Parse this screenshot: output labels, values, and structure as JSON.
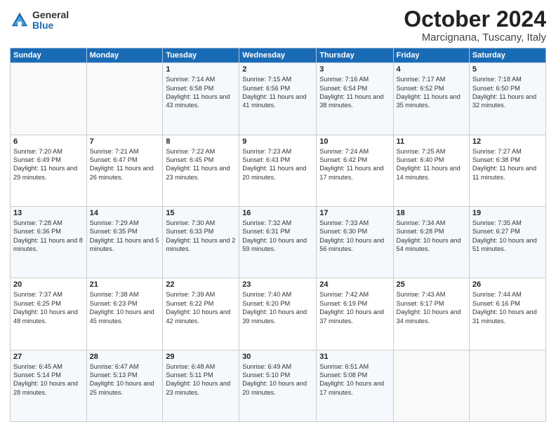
{
  "logo": {
    "general": "General",
    "blue": "Blue"
  },
  "title": "October 2024",
  "location": "Marcignana, Tuscany, Italy",
  "headers": [
    "Sunday",
    "Monday",
    "Tuesday",
    "Wednesday",
    "Thursday",
    "Friday",
    "Saturday"
  ],
  "weeks": [
    [
      {
        "day": "",
        "sunrise": "",
        "sunset": "",
        "daylight": ""
      },
      {
        "day": "",
        "sunrise": "",
        "sunset": "",
        "daylight": ""
      },
      {
        "day": "1",
        "sunrise": "Sunrise: 7:14 AM",
        "sunset": "Sunset: 6:58 PM",
        "daylight": "Daylight: 11 hours and 43 minutes."
      },
      {
        "day": "2",
        "sunrise": "Sunrise: 7:15 AM",
        "sunset": "Sunset: 6:56 PM",
        "daylight": "Daylight: 11 hours and 41 minutes."
      },
      {
        "day": "3",
        "sunrise": "Sunrise: 7:16 AM",
        "sunset": "Sunset: 6:54 PM",
        "daylight": "Daylight: 11 hours and 38 minutes."
      },
      {
        "day": "4",
        "sunrise": "Sunrise: 7:17 AM",
        "sunset": "Sunset: 6:52 PM",
        "daylight": "Daylight: 11 hours and 35 minutes."
      },
      {
        "day": "5",
        "sunrise": "Sunrise: 7:18 AM",
        "sunset": "Sunset: 6:50 PM",
        "daylight": "Daylight: 11 hours and 32 minutes."
      }
    ],
    [
      {
        "day": "6",
        "sunrise": "Sunrise: 7:20 AM",
        "sunset": "Sunset: 6:49 PM",
        "daylight": "Daylight: 11 hours and 29 minutes."
      },
      {
        "day": "7",
        "sunrise": "Sunrise: 7:21 AM",
        "sunset": "Sunset: 6:47 PM",
        "daylight": "Daylight: 11 hours and 26 minutes."
      },
      {
        "day": "8",
        "sunrise": "Sunrise: 7:22 AM",
        "sunset": "Sunset: 6:45 PM",
        "daylight": "Daylight: 11 hours and 23 minutes."
      },
      {
        "day": "9",
        "sunrise": "Sunrise: 7:23 AM",
        "sunset": "Sunset: 6:43 PM",
        "daylight": "Daylight: 11 hours and 20 minutes."
      },
      {
        "day": "10",
        "sunrise": "Sunrise: 7:24 AM",
        "sunset": "Sunset: 6:42 PM",
        "daylight": "Daylight: 11 hours and 17 minutes."
      },
      {
        "day": "11",
        "sunrise": "Sunrise: 7:25 AM",
        "sunset": "Sunset: 6:40 PM",
        "daylight": "Daylight: 11 hours and 14 minutes."
      },
      {
        "day": "12",
        "sunrise": "Sunrise: 7:27 AM",
        "sunset": "Sunset: 6:38 PM",
        "daylight": "Daylight: 11 hours and 11 minutes."
      }
    ],
    [
      {
        "day": "13",
        "sunrise": "Sunrise: 7:28 AM",
        "sunset": "Sunset: 6:36 PM",
        "daylight": "Daylight: 11 hours and 8 minutes."
      },
      {
        "day": "14",
        "sunrise": "Sunrise: 7:29 AM",
        "sunset": "Sunset: 6:35 PM",
        "daylight": "Daylight: 11 hours and 5 minutes."
      },
      {
        "day": "15",
        "sunrise": "Sunrise: 7:30 AM",
        "sunset": "Sunset: 6:33 PM",
        "daylight": "Daylight: 11 hours and 2 minutes."
      },
      {
        "day": "16",
        "sunrise": "Sunrise: 7:32 AM",
        "sunset": "Sunset: 6:31 PM",
        "daylight": "Daylight: 10 hours and 59 minutes."
      },
      {
        "day": "17",
        "sunrise": "Sunrise: 7:33 AM",
        "sunset": "Sunset: 6:30 PM",
        "daylight": "Daylight: 10 hours and 56 minutes."
      },
      {
        "day": "18",
        "sunrise": "Sunrise: 7:34 AM",
        "sunset": "Sunset: 6:28 PM",
        "daylight": "Daylight: 10 hours and 54 minutes."
      },
      {
        "day": "19",
        "sunrise": "Sunrise: 7:35 AM",
        "sunset": "Sunset: 6:27 PM",
        "daylight": "Daylight: 10 hours and 51 minutes."
      }
    ],
    [
      {
        "day": "20",
        "sunrise": "Sunrise: 7:37 AM",
        "sunset": "Sunset: 6:25 PM",
        "daylight": "Daylight: 10 hours and 48 minutes."
      },
      {
        "day": "21",
        "sunrise": "Sunrise: 7:38 AM",
        "sunset": "Sunset: 6:23 PM",
        "daylight": "Daylight: 10 hours and 45 minutes."
      },
      {
        "day": "22",
        "sunrise": "Sunrise: 7:39 AM",
        "sunset": "Sunset: 6:22 PM",
        "daylight": "Daylight: 10 hours and 42 minutes."
      },
      {
        "day": "23",
        "sunrise": "Sunrise: 7:40 AM",
        "sunset": "Sunset: 6:20 PM",
        "daylight": "Daylight: 10 hours and 39 minutes."
      },
      {
        "day": "24",
        "sunrise": "Sunrise: 7:42 AM",
        "sunset": "Sunset: 6:19 PM",
        "daylight": "Daylight: 10 hours and 37 minutes."
      },
      {
        "day": "25",
        "sunrise": "Sunrise: 7:43 AM",
        "sunset": "Sunset: 6:17 PM",
        "daylight": "Daylight: 10 hours and 34 minutes."
      },
      {
        "day": "26",
        "sunrise": "Sunrise: 7:44 AM",
        "sunset": "Sunset: 6:16 PM",
        "daylight": "Daylight: 10 hours and 31 minutes."
      }
    ],
    [
      {
        "day": "27",
        "sunrise": "Sunrise: 6:45 AM",
        "sunset": "Sunset: 5:14 PM",
        "daylight": "Daylight: 10 hours and 28 minutes."
      },
      {
        "day": "28",
        "sunrise": "Sunrise: 6:47 AM",
        "sunset": "Sunset: 5:13 PM",
        "daylight": "Daylight: 10 hours and 25 minutes."
      },
      {
        "day": "29",
        "sunrise": "Sunrise: 6:48 AM",
        "sunset": "Sunset: 5:11 PM",
        "daylight": "Daylight: 10 hours and 23 minutes."
      },
      {
        "day": "30",
        "sunrise": "Sunrise: 6:49 AM",
        "sunset": "Sunset: 5:10 PM",
        "daylight": "Daylight: 10 hours and 20 minutes."
      },
      {
        "day": "31",
        "sunrise": "Sunrise: 6:51 AM",
        "sunset": "Sunset: 5:08 PM",
        "daylight": "Daylight: 10 hours and 17 minutes."
      },
      {
        "day": "",
        "sunrise": "",
        "sunset": "",
        "daylight": ""
      },
      {
        "day": "",
        "sunrise": "",
        "sunset": "",
        "daylight": ""
      }
    ]
  ]
}
